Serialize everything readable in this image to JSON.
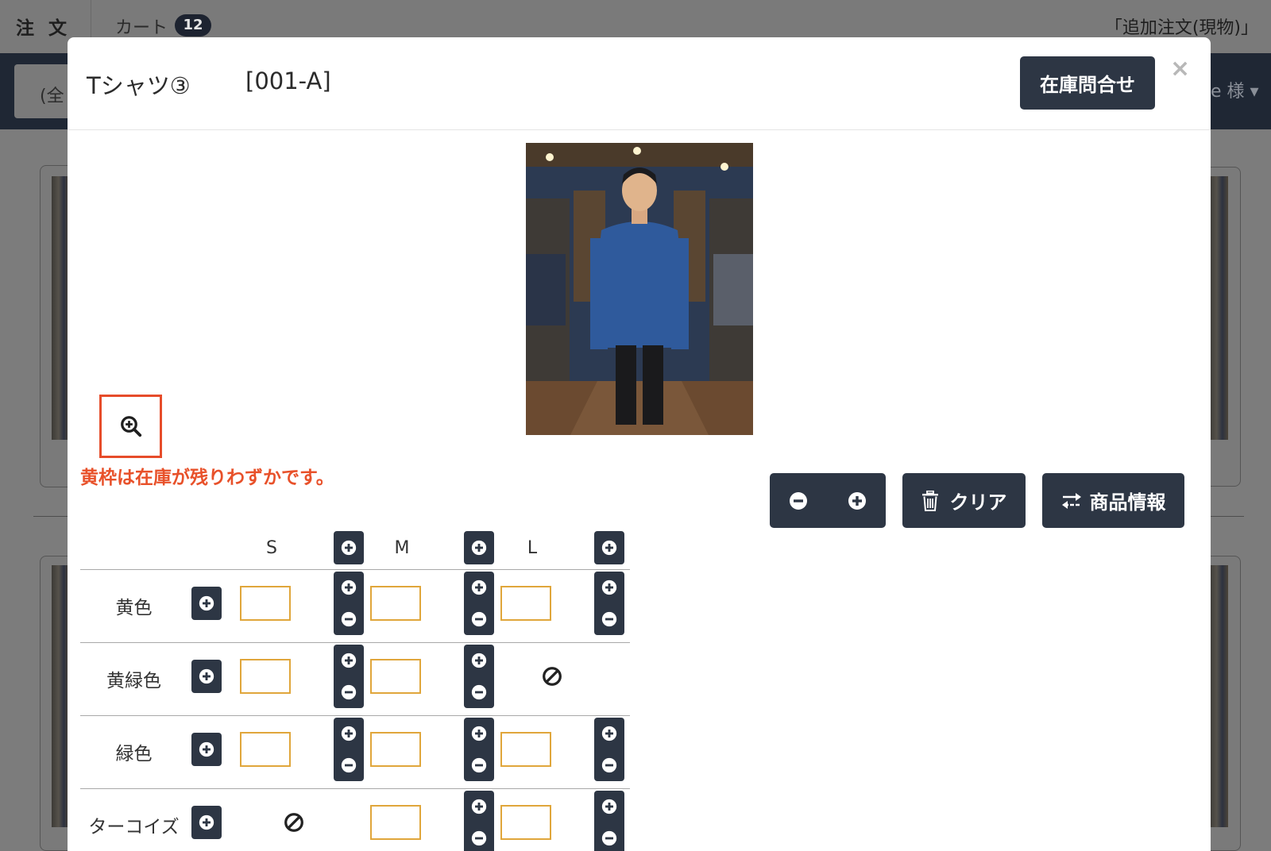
{
  "background": {
    "topbar": {
      "order_label": "注文",
      "cart_label": "カート",
      "cart_count": "12",
      "right_text": "「追加注文(現物)」"
    },
    "nav": {
      "select_text": "(全",
      "user_text": "ne 様"
    }
  },
  "modal": {
    "title": "Tシャツ③",
    "code": "[001-A]",
    "stock_inquiry_button": "在庫問合せ",
    "close_symbol": "×",
    "low_stock_note": "黄枠は在庫が残りわずかです。",
    "buttons": {
      "clear": "クリア",
      "product_info": "商品情報"
    },
    "grid": {
      "sizes": [
        "S",
        "M",
        "L"
      ],
      "rows": [
        {
          "color": "黄色",
          "available": [
            true,
            true,
            true
          ]
        },
        {
          "color": "黄緑色",
          "available": [
            true,
            true,
            false
          ]
        },
        {
          "color": "緑色",
          "available": [
            true,
            true,
            true
          ]
        },
        {
          "color": "ターコイズ",
          "available": [
            false,
            true,
            true
          ]
        }
      ]
    }
  },
  "colors": {
    "dark_button": "#2d3644",
    "low_stock_border": "#e0a63b",
    "note_red": "#e8512a",
    "navbar": "#1f2734"
  },
  "icons": {
    "zoom": "zoom-in-icon",
    "minus": "minus-circle-icon",
    "plus": "plus-circle-icon",
    "trash": "trash-icon",
    "swap": "swap-arrows-icon",
    "not_available": "not-available-icon"
  }
}
